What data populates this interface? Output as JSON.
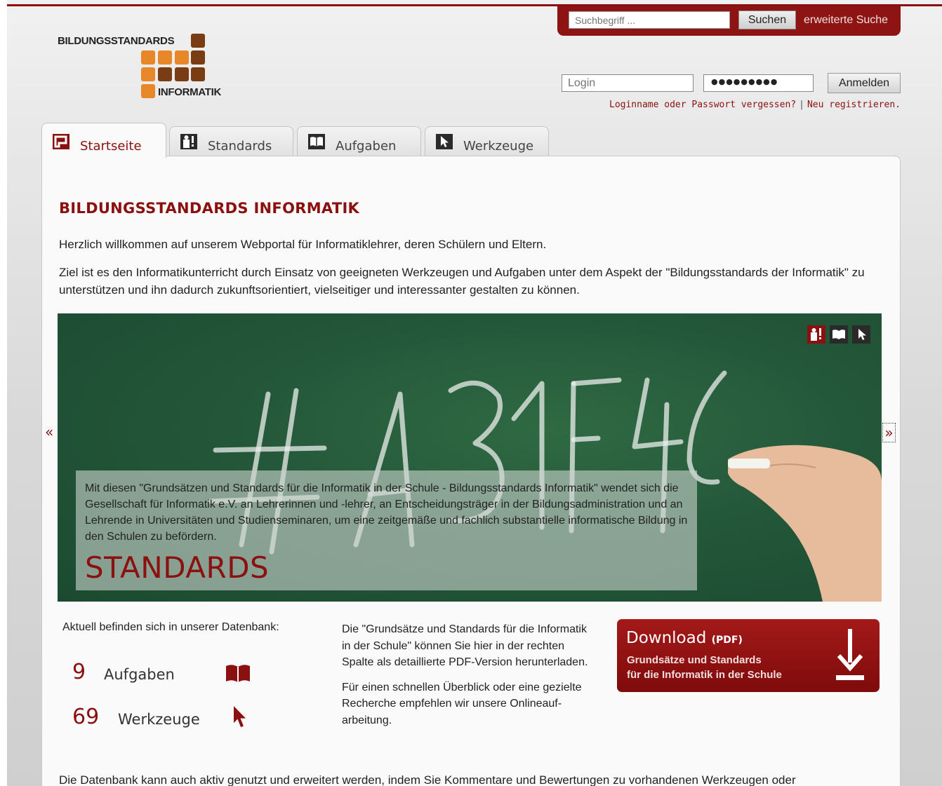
{
  "logo": {
    "line1": "BILDUNGSSTANDARDS",
    "line2": "INFORMATIK",
    "colors": {
      "dark": "#7a3c12",
      "orange": "#e8872a"
    }
  },
  "search": {
    "placeholder": "Suchbegriff ...",
    "button_label": "Suchen",
    "advanced_link": "erweiterte Suche"
  },
  "login": {
    "login_placeholder": "Login",
    "password_mask": "●●●●●●●●●",
    "button_label": "Anmelden",
    "forgot_link": "Loginname oder Passwort vergessen?",
    "separator": "|",
    "register_link": "Neu registrieren."
  },
  "tabs": [
    {
      "label": "Startseite",
      "icon": "home-icon",
      "active": true
    },
    {
      "label": "Standards",
      "icon": "standards-icon",
      "active": false
    },
    {
      "label": "Aufgaben",
      "icon": "book-icon",
      "active": false
    },
    {
      "label": "Werkzeuge",
      "icon": "cursor-icon",
      "active": false
    }
  ],
  "main": {
    "title": "BILDUNGSSTANDARDS INFORMATIK",
    "intro": "Herzlich willkommen auf unserem Webportal für Informatiklehrer, deren Schülern und Eltern.",
    "goal": "Ziel ist es den Informatikunterricht durch Einsatz von geeigneten Werkzeugen und Aufgaben unter dem Aspekt der \"Bildungsstandards der Informatik\" zu unterstützen und ihn dadurch zukunftsorientiert, vielseitiger und interessanter gestalten zu können."
  },
  "banner": {
    "chalk_text": "#A31F4C",
    "caption": "Mit diesen \"Grundsätzen und Standards für die Informatik in der Schule - Bildungsstandards Informatik\" wendet sich die Gesellschaft für Informatik e.V. an Lehrerinnen und -lehrer, an Entscheidungsträger in der Bildungsadministration und an Lehrende in Universitäten und Studienseminaren, um eine zeitgemäße und fachlich substantielle informatische Bildung in den Schulen zu befördern.",
    "caption_title": "STANDARDS",
    "prev": "«",
    "next": "»",
    "icons": [
      "standards-icon",
      "book-icon",
      "cursor-icon"
    ]
  },
  "database": {
    "intro": "Aktuell befinden sich in unserer Datenbank:",
    "stats": [
      {
        "count": "9",
        "label": "Aufgaben",
        "icon": "book-icon"
      },
      {
        "count": "69",
        "label": "Werkzeuge",
        "icon": "cursor-icon"
      }
    ]
  },
  "info": {
    "p1": "Die \"Grundsätze und Standards für die Informatik in der Schule\" können Sie hier in der rechten Spalte als detaillierte PDF-Version herunterladen.",
    "p2": "Für einen schnellen Überblick oder eine gezielte Recherche empfehlen wir unsere Onlineauf-arbeitung."
  },
  "download": {
    "title": "Download",
    "format": "(PDF)",
    "line1": "Grundsätze und Standards",
    "line2": "für die Informatik in der Schule",
    "icon": "download-arrow-icon"
  },
  "bottom_text": "Die Datenbank kann auch aktiv genutzt und erweitert werden, indem Sie Kommentare und Bewertungen zu vorhandenen Werkzeugen oder",
  "colors": {
    "brand_red": "#8b1010",
    "chalkboard": "#24573a"
  }
}
